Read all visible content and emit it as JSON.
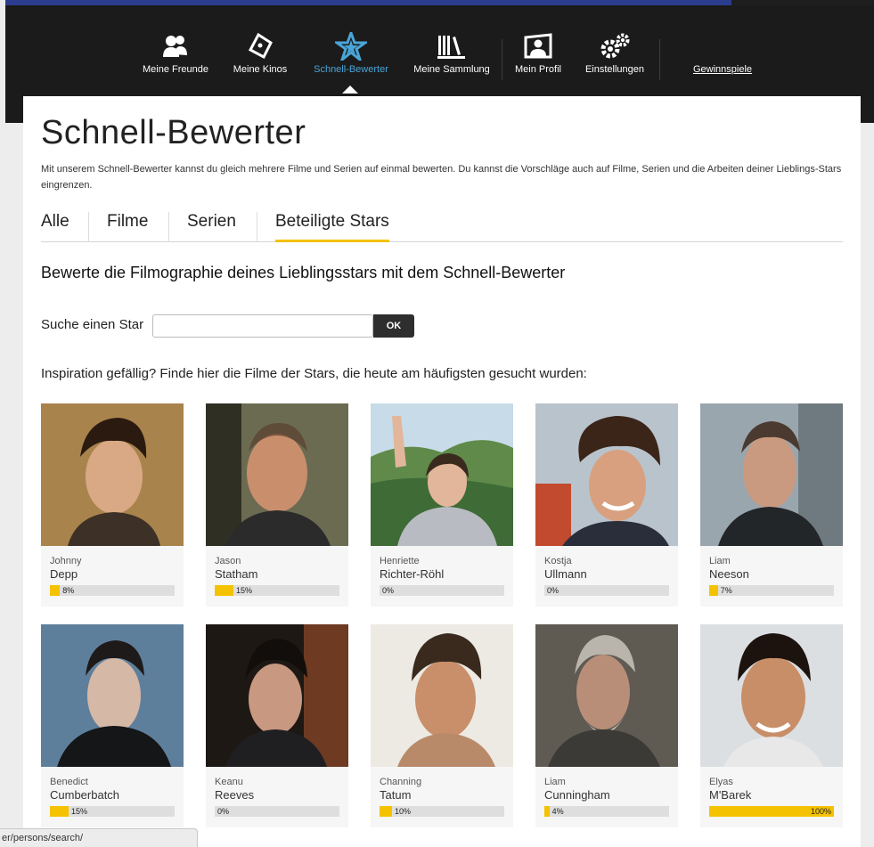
{
  "nav": {
    "items": [
      {
        "label": "Meine Freunde",
        "icon": "friends-icon"
      },
      {
        "label": "Meine Kinos",
        "icon": "ticket-icon"
      },
      {
        "label": "Schnell-Bewerter",
        "icon": "star-icon"
      },
      {
        "label": "Meine Sammlung",
        "icon": "library-icon"
      },
      {
        "label": "Mein Profil",
        "icon": "profile-icon"
      },
      {
        "label": "Einstellungen",
        "icon": "gears-icon"
      },
      {
        "label": "Gewinnspiele"
      }
    ],
    "active_color": "#4aa5d8"
  },
  "page": {
    "title": "Schnell-Bewerter",
    "intro": "Mit unserem Schnell-Bewerter kannst du gleich mehrere Filme und Serien auf einmal bewerten. Du kannst die Vorschläge auch auf Filme, Serien und die Arbeiten deiner Lieblings-Stars eingrenzen.",
    "tabs": [
      "Alle",
      "Filme",
      "Serien",
      "Beteiligte Stars"
    ],
    "active_tab": "Beteiligte Stars",
    "subtitle": "Bewerte die Filmographie deines Lieblingsstars mit dem Schnell-Bewerter",
    "search_label": "Suche einen Star",
    "search_value": "",
    "search_button": "OK",
    "inspiration": "Inspiration gefällig? Finde hier die Filme der Stars, die heute am häufigsten gesucht wurden:"
  },
  "stars": [
    {
      "first": "Johnny",
      "last": "Depp",
      "progress": 8,
      "progress_label": "8%"
    },
    {
      "first": "Jason",
      "last": "Statham",
      "progress": 15,
      "progress_label": "15%"
    },
    {
      "first": "Henriette",
      "last": "Richter-Röhl",
      "progress": 0,
      "progress_label": "0%"
    },
    {
      "first": "Kostja",
      "last": "Ullmann",
      "progress": 0,
      "progress_label": "0%"
    },
    {
      "first": "Liam",
      "last": "Neeson",
      "progress": 7,
      "progress_label": "7%"
    },
    {
      "first": "Benedict",
      "last": "Cumberbatch",
      "progress": 15,
      "progress_label": "15%"
    },
    {
      "first": "Keanu",
      "last": "Reeves",
      "progress": 0,
      "progress_label": "0%"
    },
    {
      "first": "Channing",
      "last": "Tatum",
      "progress": 10,
      "progress_label": "10%"
    },
    {
      "first": "Liam",
      "last": "Cunningham",
      "progress": 4,
      "progress_label": "4%"
    },
    {
      "first": "Elyas",
      "last": "M'Barek",
      "progress": 100,
      "progress_label": "100%"
    }
  ],
  "colors": {
    "accent": "#f5c200",
    "topbar": "#1b1b1b",
    "browser_blue": "#2b3d8f"
  },
  "statusbar": "er/persons/search/"
}
